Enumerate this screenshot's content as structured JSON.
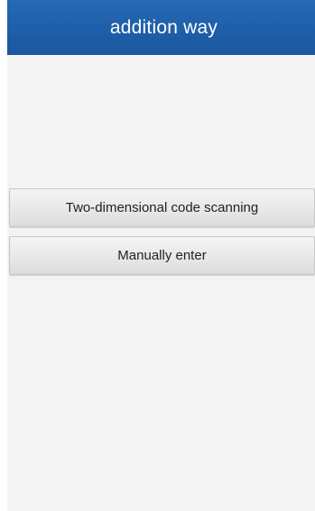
{
  "header": {
    "title": "addition way"
  },
  "actions": {
    "scan_label": "Two-dimensional code scanning",
    "manual_label": "Manually enter"
  },
  "colors": {
    "header_bg": "#1d5ea8",
    "page_bg": "#f3f3f3",
    "button_bg": "#e8e8e8"
  }
}
